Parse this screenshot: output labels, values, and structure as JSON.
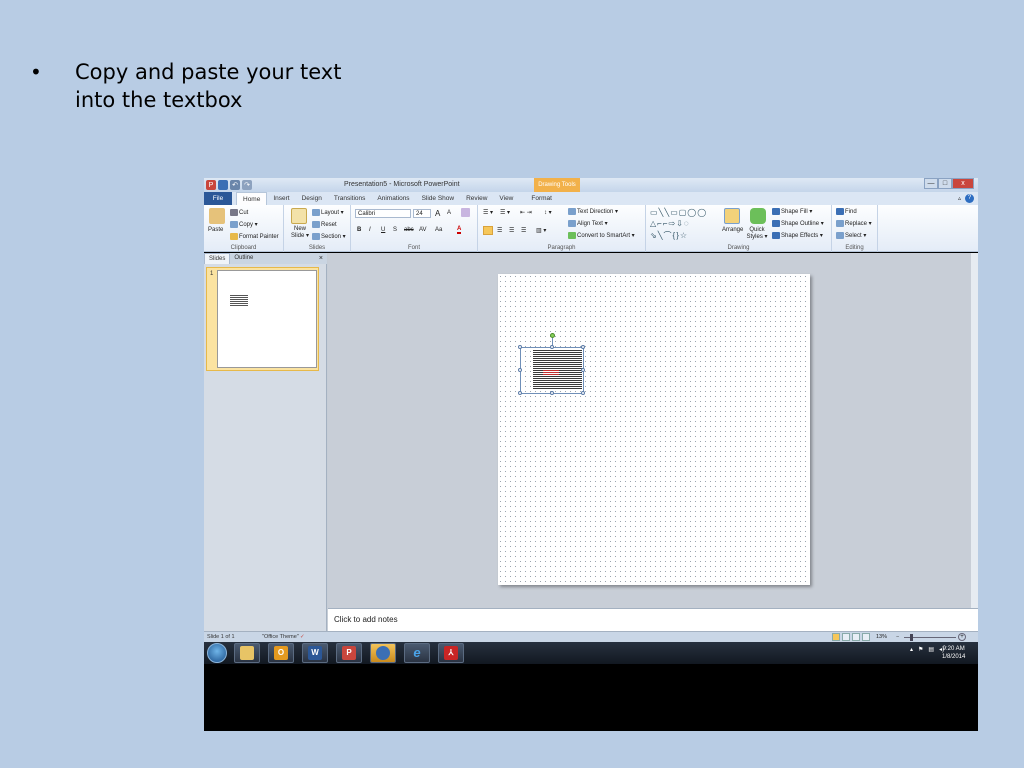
{
  "bullet": {
    "symbol": "•",
    "text": "Copy and paste your text into the textbox"
  },
  "window": {
    "title": "Presentation5 - Microsoft PowerPoint",
    "context_tab": "Drawing Tools",
    "min": "—",
    "max": "□",
    "close": "x"
  },
  "tabs": [
    "File",
    "Home",
    "Insert",
    "Design",
    "Transitions",
    "Animations",
    "Slide Show",
    "Review",
    "View",
    "Format"
  ],
  "ribbon": {
    "clipboard": {
      "paste": "Paste",
      "cut": "Cut",
      "copy": "Copy ▾",
      "format_painter": "Format Painter",
      "name": "Clipboard"
    },
    "slides": {
      "new_slide": "New Slide ▾",
      "layout": "Layout ▾",
      "reset": "Reset",
      "section": "Section ▾",
      "name": "Slides"
    },
    "font": {
      "family": "Calibri",
      "size": "24",
      "grow": "A",
      "shrink": "A",
      "bold": "B",
      "italic": "I",
      "underline": "U",
      "shadow": "S",
      "strike": "abc",
      "spacing": "AV",
      "case": "Aa",
      "color": "A",
      "name": "Font"
    },
    "paragraph": {
      "text_direction": "Text Direction ▾",
      "align_text": "Align Text ▾",
      "convert_smartart": "Convert to SmartArt ▾",
      "name": "Paragraph"
    },
    "drawing": {
      "arrange": "Arrange",
      "quick_styles": "Quick Styles ▾",
      "shape_fill": "Shape Fill ▾",
      "shape_outline": "Shape Outline ▾",
      "shape_effects": "Shape Effects ▾",
      "name": "Drawing"
    },
    "editing": {
      "find": "Find",
      "replace": "Replace ▾",
      "select": "Select ▾",
      "name": "Editing"
    }
  },
  "panel": {
    "tab_slides": "Slides",
    "tab_outline": "Outline",
    "close": "×",
    "slide_number": "1"
  },
  "notes_placeholder": "Click to add notes",
  "status": {
    "slide": "Slide 1 of 1",
    "theme": "\"Office Theme\"",
    "zoom": "13%",
    "zoom_minus": "−",
    "zoom_plus": "+"
  },
  "taskbar": {
    "time": "9:20 AM",
    "date": "1/8/2014"
  },
  "colors": {
    "background": "#b8cce4",
    "file_tab": "#2b5797",
    "context_tab": "#f2b14a"
  }
}
